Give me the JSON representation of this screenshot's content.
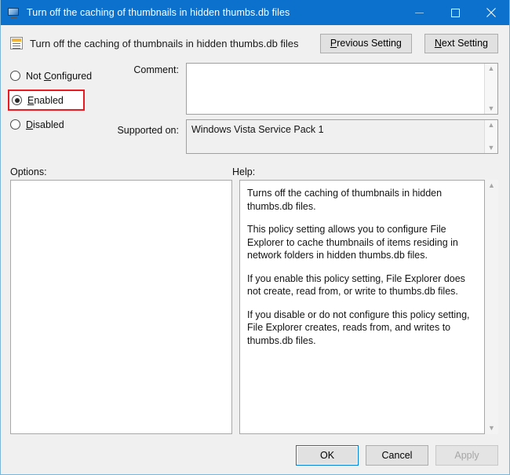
{
  "window": {
    "title": "Turn off the caching of thumbnails in hidden thumbs.db files",
    "icon": "policy-window-icon",
    "controls": {
      "minimize": "minimize-icon",
      "maximize": "maximize-icon",
      "close": "close-icon"
    },
    "accent_color": "#0c70cd",
    "border_color": "#7cb5d8"
  },
  "header": {
    "setting_name": "Turn off the caching of thumbnails in hidden thumbs.db files",
    "icon": "group-policy-setting-icon",
    "previous_button": {
      "prefix": "",
      "accel": "P",
      "suffix": "revious Setting"
    },
    "next_button": {
      "prefix": "",
      "accel": "N",
      "suffix": "ext Setting"
    }
  },
  "state_options": {
    "selected": "Enabled",
    "highlight_color": "#e81b23",
    "items": [
      {
        "label_prefix": "Not ",
        "accel": "C",
        "label_suffix": "onfigured",
        "checked": false,
        "highlighted": false
      },
      {
        "label_prefix": "",
        "accel": "E",
        "label_suffix": "nabled",
        "checked": true,
        "highlighted": true
      },
      {
        "label_prefix": "",
        "accel": "D",
        "label_suffix": "isabled",
        "checked": false,
        "highlighted": false
      }
    ]
  },
  "fields": {
    "comment_label": "Comment:",
    "comment_value": "",
    "comment_placeholder": "",
    "supported_label": "Supported on:",
    "supported_value": "Windows Vista Service Pack 1"
  },
  "panels": {
    "options_label": "Options:",
    "options_content": "",
    "help_label": "Help:",
    "help_paragraphs": [
      "Turns off the caching of thumbnails in hidden thumbs.db files.",
      "This policy setting allows you to configure File Explorer to cache thumbnails of items residing in network folders in hidden thumbs.db files.",
      "If you enable this policy setting, File Explorer does not create, read from, or write to thumbs.db files.",
      "If you disable or do not configure this policy setting, File Explorer creates, reads from, and writes to thumbs.db files."
    ]
  },
  "footer": {
    "ok_label": "OK",
    "cancel_label": "Cancel",
    "apply_label": "Apply",
    "apply_enabled": false,
    "default_button": "OK"
  },
  "scroll_icons": {
    "up": "chevron-up-icon",
    "down": "chevron-down-icon"
  }
}
